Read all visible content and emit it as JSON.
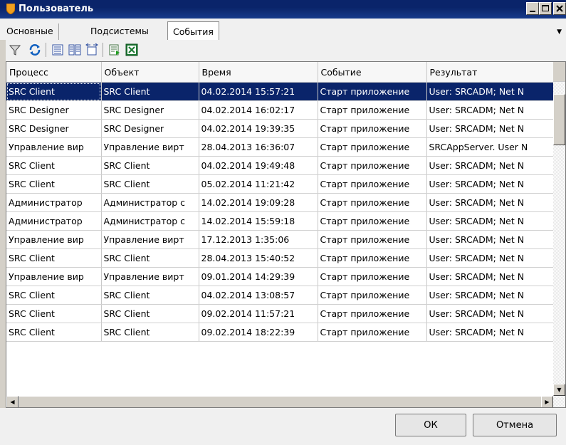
{
  "window": {
    "title": "Пользователь"
  },
  "tabs": [
    {
      "label": "Основные"
    },
    {
      "label": "Подсистемы"
    },
    {
      "label": "События"
    }
  ],
  "toolbar": {
    "icons": [
      "filter-icon",
      "refresh-icon",
      "list-view-icon",
      "details-icon",
      "expand-columns-icon",
      "export-icon",
      "excel-icon"
    ]
  },
  "grid": {
    "columns": [
      "Процесс",
      "Объект",
      "Время",
      "Событие",
      "Результат"
    ],
    "rows": [
      [
        "SRC Client",
        "SRC Client",
        "04.02.2014 15:57:21",
        "Старт приложение",
        "User: SRCADM; Net N"
      ],
      [
        "SRC Designer",
        "SRC Designer",
        "04.02.2014 16:02:17",
        "Старт приложение",
        "User: SRCADM; Net N"
      ],
      [
        "SRC Designer",
        "SRC Designer",
        "04.02.2014 19:39:35",
        "Старт приложение",
        "User: SRCADM; Net N"
      ],
      [
        "Управление вир",
        "Управление вирт",
        "28.04.2013 16:36:07",
        "Старт приложение",
        "SRCAppServer. User N"
      ],
      [
        "SRC Client",
        "SRC Client",
        "04.02.2014 19:49:48",
        "Старт приложение",
        "User: SRCADM; Net N"
      ],
      [
        "SRC Client",
        "SRC Client",
        "05.02.2014 11:21:42",
        "Старт приложение",
        "User: SRCADM; Net N"
      ],
      [
        "Администратор",
        "Администратор с",
        "14.02.2014 19:09:28",
        "Старт приложение",
        "User: SRCADM; Net N"
      ],
      [
        "Администратор",
        "Администратор с",
        "14.02.2014 15:59:18",
        "Старт приложение",
        "User: SRCADM; Net N"
      ],
      [
        "Управление вир",
        "Управление вирт",
        "17.12.2013 1:35:06",
        "Старт приложение",
        "User: SRCADM; Net N"
      ],
      [
        "SRC Client",
        "SRC Client",
        "28.04.2013 15:40:52",
        "Старт приложение",
        "User: SRCADM; Net N"
      ],
      [
        "Управление вир",
        "Управление вирт",
        "09.01.2014 14:29:39",
        "Старт приложение",
        "User: SRCADM; Net N"
      ],
      [
        "SRC Client",
        "SRC Client",
        "04.02.2014 13:08:57",
        "Старт приложение",
        "User: SRCADM; Net N"
      ],
      [
        "SRC Client",
        "SRC Client",
        "09.02.2014 11:57:21",
        "Старт приложение",
        "User: SRCADM; Net N"
      ],
      [
        "SRC Client",
        "SRC Client",
        "09.02.2014 18:22:39",
        "Старт приложение",
        "User: SRCADM; Net N"
      ]
    ],
    "selected_row": 0
  },
  "buttons": {
    "ok": "ОК",
    "cancel": "Отмена"
  },
  "colors": {
    "title_bar": "#0a246a",
    "selection": "#0a246a"
  }
}
